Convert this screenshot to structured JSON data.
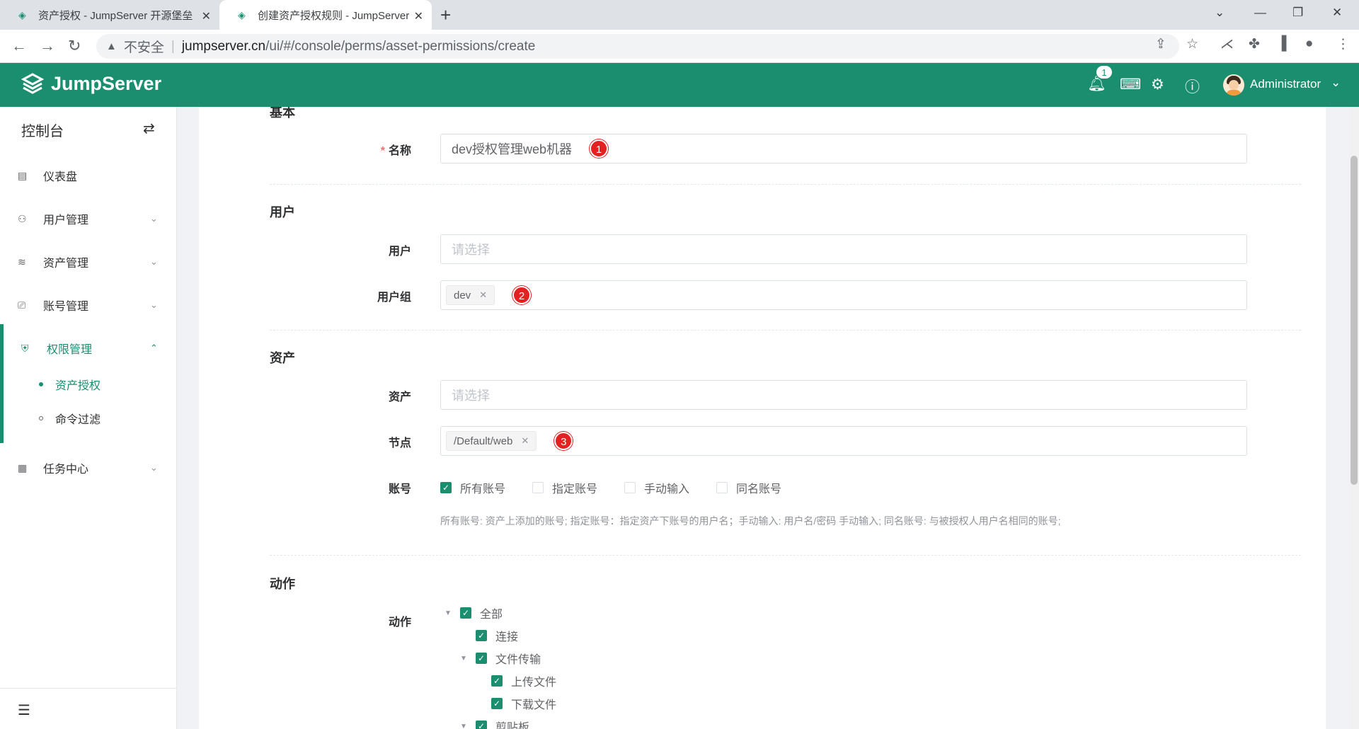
{
  "browser": {
    "tabs": [
      {
        "title": "资产授权 - JumpServer 开源堡垒",
        "active": false
      },
      {
        "title": "创建资产授权规则 - JumpServer",
        "active": true
      }
    ],
    "address": {
      "insecure_label": "不安全",
      "host": "jumpserver.cn",
      "path": "/ui/#/console/perms/asset-permissions/create"
    }
  },
  "header": {
    "brand": "JumpServer",
    "notification_count": "1",
    "username": "Administrator",
    "theme_color": "#1b8e6f"
  },
  "sidebar": {
    "title": "控制台",
    "items": [
      {
        "label": "仪表盘",
        "icon": "dashboard-icon",
        "expandable": false
      },
      {
        "label": "用户管理",
        "icon": "users-icon",
        "expandable": true
      },
      {
        "label": "资产管理",
        "icon": "layers-icon",
        "expandable": true
      },
      {
        "label": "账号管理",
        "icon": "account-icon",
        "expandable": true
      },
      {
        "label": "权限管理",
        "icon": "shield-icon",
        "expandable": true,
        "open": true
      },
      {
        "label": "任务中心",
        "icon": "calendar-icon",
        "expandable": true
      }
    ],
    "subitems": [
      {
        "label": "资产授权",
        "active": true
      },
      {
        "label": "命令过滤",
        "active": false
      }
    ]
  },
  "form": {
    "sections": {
      "basic": "基本",
      "user": "用户",
      "asset": "资产",
      "action": "动作"
    },
    "name": {
      "label": "名称",
      "value": "dev授权管理web机器",
      "marker": "1"
    },
    "users": {
      "label": "用户",
      "placeholder": "请选择"
    },
    "user_groups": {
      "label": "用户组",
      "tags": [
        "dev"
      ],
      "marker": "2"
    },
    "assets": {
      "label": "资产",
      "placeholder": "请选择"
    },
    "nodes": {
      "label": "节点",
      "tags": [
        "/Default/web"
      ],
      "marker": "3"
    },
    "accounts": {
      "label": "账号",
      "options": [
        {
          "label": "所有账号",
          "checked": true
        },
        {
          "label": "指定账号",
          "checked": false
        },
        {
          "label": "手动输入",
          "checked": false
        },
        {
          "label": "同名账号",
          "checked": false
        }
      ],
      "hint": "所有账号: 资产上添加的账号; 指定账号：指定资产下账号的用户名；手动输入: 用户名/密码 手动输入; 同名账号: 与被授权人用户名相同的账号;"
    },
    "actions": {
      "label": "动作",
      "tree": [
        {
          "label": "全部",
          "checked": true,
          "level": 0,
          "expandable": true
        },
        {
          "label": "连接",
          "checked": true,
          "level": 1,
          "expandable": false
        },
        {
          "label": "文件传输",
          "checked": true,
          "level": 1,
          "expandable": true
        },
        {
          "label": "上传文件",
          "checked": true,
          "level": 2,
          "expandable": false
        },
        {
          "label": "下载文件",
          "checked": true,
          "level": 2,
          "expandable": false
        },
        {
          "label": "剪贴板",
          "checked": true,
          "level": 1,
          "expandable": true
        }
      ]
    }
  }
}
